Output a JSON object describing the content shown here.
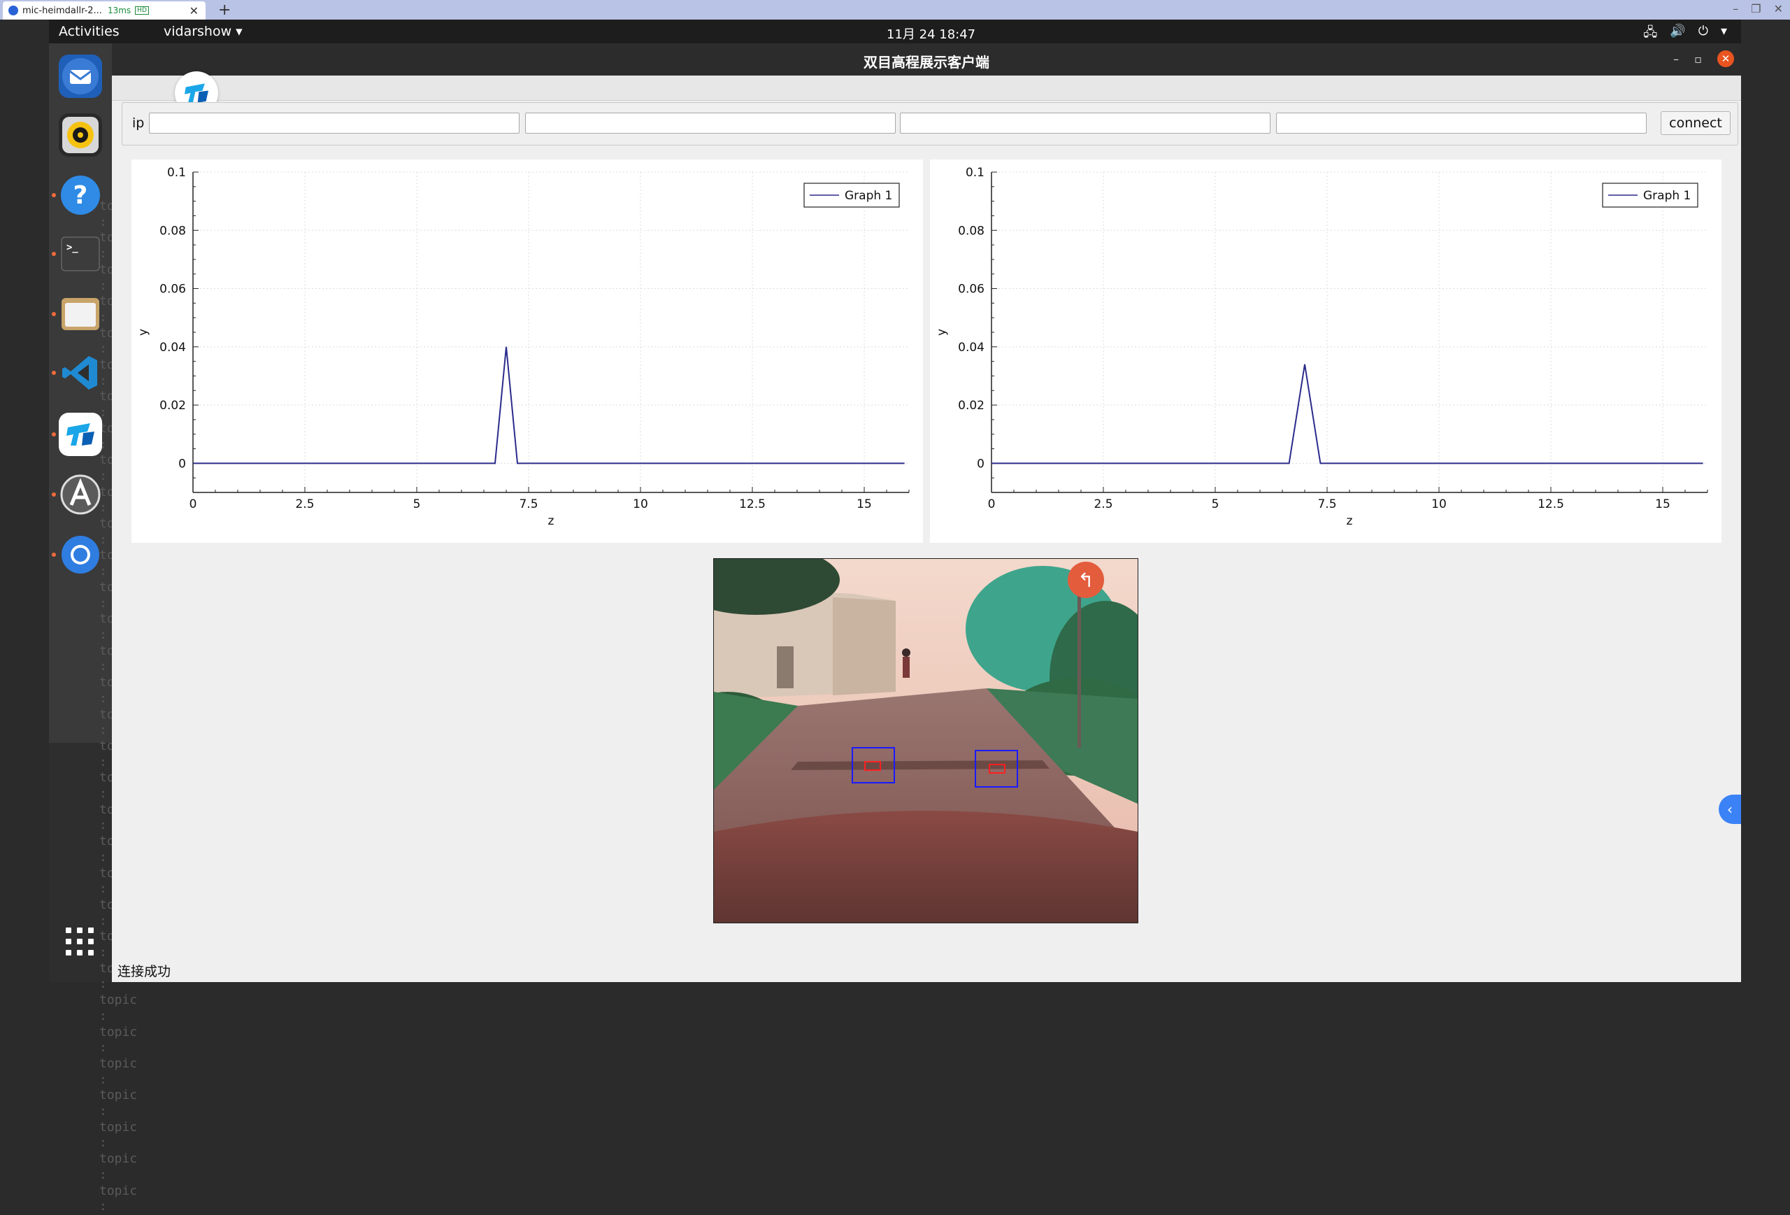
{
  "remote_desktop": {
    "tab_title": "mic-heimdallr-2...",
    "ping": "13ms",
    "hd_badge": "HD",
    "close_glyph": "✕",
    "new_tab_glyph": "+"
  },
  "gnome": {
    "activities": "Activities",
    "app_menu": "vidarshow ▾",
    "clock": "11月 24  18:47",
    "tray_icons": [
      "network-icon",
      "volume-icon",
      "power-icon",
      "chevron-down-icon"
    ]
  },
  "dock": {
    "apps": [
      "thunderbird-icon",
      "rhythmbox-icon",
      "help-icon",
      "terminal-icon",
      "files-icon",
      "vscode-icon",
      "todesk-icon",
      "software-updater-icon",
      "chromium-icon"
    ],
    "background_text": "topic :"
  },
  "window": {
    "title": "双目高程展示客户端",
    "minimize": "–",
    "maximize": "▫",
    "close": "✕"
  },
  "connection": {
    "ip_label": "ip",
    "fields": [
      "",
      "",
      "",
      ""
    ],
    "connect_label": "connect"
  },
  "status": {
    "message": "连接成功"
  },
  "colors": {
    "line": "#2b2b8c",
    "accent_close": "#e95420",
    "handle": "#3b82f6"
  },
  "chart_data": [
    {
      "type": "line",
      "xlabel": "z",
      "ylabel": "y",
      "xlim": [
        0,
        16
      ],
      "ylim": [
        -0.01,
        0.1
      ],
      "xticks": [
        "0",
        "2.5",
        "5",
        "7.5",
        "10",
        "12.5",
        "15"
      ],
      "yticks": [
        "0",
        "0.02",
        "0.04",
        "0.06",
        "0.08",
        "0.1"
      ],
      "grid": true,
      "legend": "top-right",
      "series": [
        {
          "name": "Graph 1",
          "x": [
            0,
            6.75,
            7.0,
            7.25,
            15.9
          ],
          "y": [
            0,
            0,
            0.04,
            0,
            0
          ]
        }
      ]
    },
    {
      "type": "line",
      "xlabel": "z",
      "ylabel": "y",
      "xlim": [
        0,
        16
      ],
      "ylim": [
        -0.01,
        0.1
      ],
      "xticks": [
        "0",
        "2.5",
        "5",
        "7.5",
        "10",
        "12.5",
        "15"
      ],
      "yticks": [
        "0",
        "0.02",
        "0.04",
        "0.06",
        "0.08",
        "0.1"
      ],
      "grid": true,
      "legend": "top-right",
      "series": [
        {
          "name": "Graph 1",
          "x": [
            0,
            6.65,
            7.0,
            7.35,
            15.9
          ],
          "y": [
            0,
            0,
            0.034,
            0,
            0
          ]
        }
      ]
    }
  ]
}
